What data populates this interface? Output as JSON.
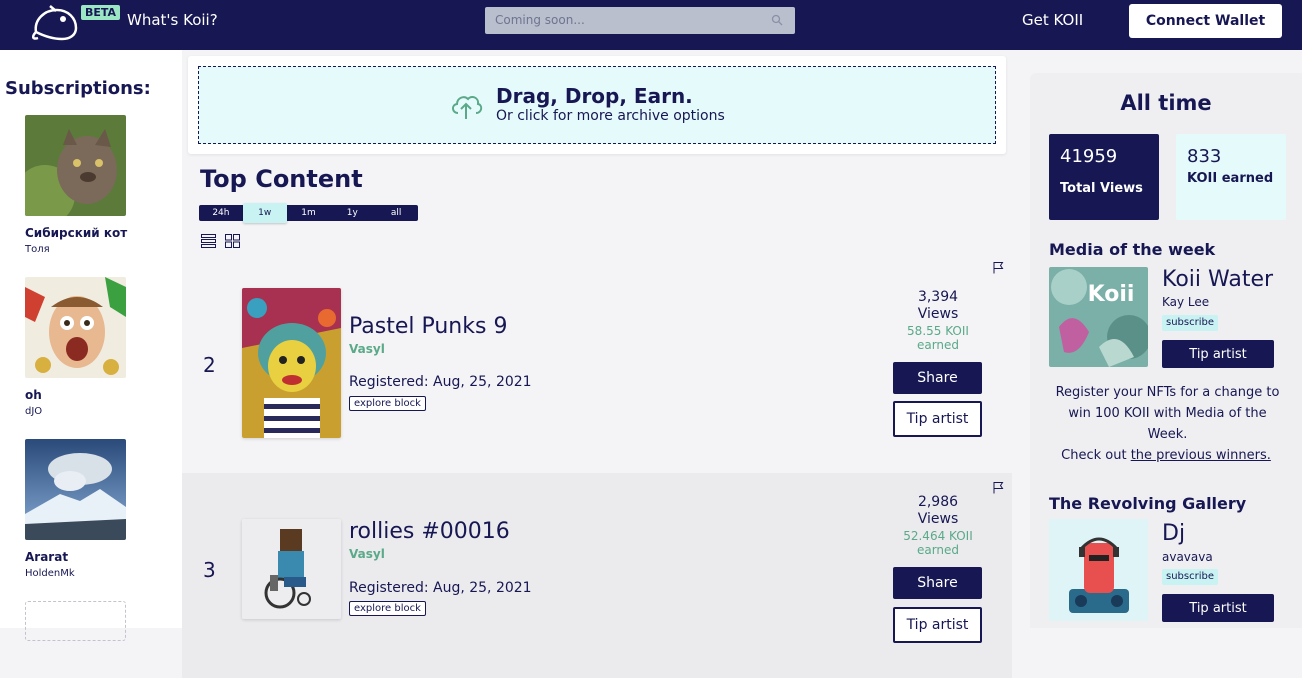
{
  "header": {
    "beta": "BETA",
    "whats": "What's Koii?",
    "search_placeholder": "Coming soon...",
    "get_koii": "Get KOII",
    "connect": "Connect Wallet"
  },
  "subscriptions": {
    "title": "Subscriptions:",
    "items": [
      {
        "name": "Сибирский кот",
        "user": "Толя"
      },
      {
        "name": "oh",
        "user": "dJO"
      },
      {
        "name": "Ararat",
        "user": "HoldenMk"
      }
    ]
  },
  "upload": {
    "title": "Drag, Drop, Earn.",
    "subtitle": "Or click for more archive options"
  },
  "top_content": {
    "title": "Top Content",
    "periods": [
      "24h",
      "1w",
      "1m",
      "1y",
      "all"
    ],
    "active_period": "1w",
    "items": [
      {
        "rank": "2",
        "title": "Pastel Punks 9",
        "artist": "Vasyl",
        "registered": "Registered: Aug, 25, 2021",
        "explore": "explore block",
        "views": "3,394",
        "views_label": "Views",
        "earned": "58.55 KOII",
        "earned_label": "earned",
        "share": "Share",
        "tip": "Tip artist"
      },
      {
        "rank": "3",
        "title": "rollies #00016",
        "artist": "Vasyl",
        "registered": "Registered: Aug, 25, 2021",
        "explore": "explore block",
        "views": "2,986",
        "views_label": "Views",
        "earned": "52.464 KOII",
        "earned_label": "earned",
        "share": "Share",
        "tip": "Tip artist"
      }
    ]
  },
  "sidebar_right": {
    "title": "All time",
    "total_views": "41959",
    "total_views_label": "Total Views",
    "koii_earned": "833",
    "koii_earned_label": "KOII earned",
    "motw": {
      "title": "Media of the week",
      "thumb_label": "Koii",
      "name": "Koii Water",
      "user": "Kay Lee",
      "subscribe": "subscribe",
      "tip": "Tip artist",
      "text": "Register your NFTs for a change to win 100 KOII with Media of the Week.",
      "check_out": "Check out",
      "winners_link": "the previous winners."
    },
    "revolving": {
      "title": "The Revolving Gallery",
      "name": "Dj",
      "user": "avavava",
      "subscribe": "subscribe",
      "tip": "Tip artist"
    }
  }
}
